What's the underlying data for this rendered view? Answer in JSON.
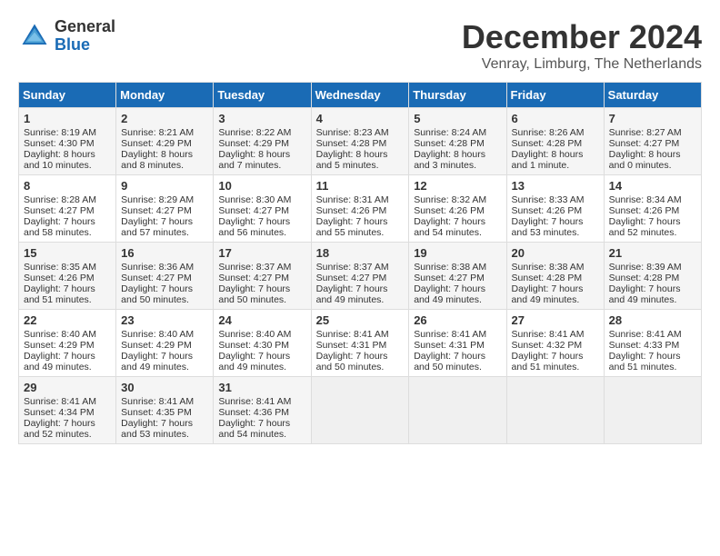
{
  "header": {
    "logo_general": "General",
    "logo_blue": "Blue",
    "month_title": "December 2024",
    "location": "Venray, Limburg, The Netherlands"
  },
  "days_of_week": [
    "Sunday",
    "Monday",
    "Tuesday",
    "Wednesday",
    "Thursday",
    "Friday",
    "Saturday"
  ],
  "weeks": [
    [
      {
        "day": "1",
        "sunrise": "Sunrise: 8:19 AM",
        "sunset": "Sunset: 4:30 PM",
        "daylight": "Daylight: 8 hours and 10 minutes."
      },
      {
        "day": "2",
        "sunrise": "Sunrise: 8:21 AM",
        "sunset": "Sunset: 4:29 PM",
        "daylight": "Daylight: 8 hours and 8 minutes."
      },
      {
        "day": "3",
        "sunrise": "Sunrise: 8:22 AM",
        "sunset": "Sunset: 4:29 PM",
        "daylight": "Daylight: 8 hours and 7 minutes."
      },
      {
        "day": "4",
        "sunrise": "Sunrise: 8:23 AM",
        "sunset": "Sunset: 4:28 PM",
        "daylight": "Daylight: 8 hours and 5 minutes."
      },
      {
        "day": "5",
        "sunrise": "Sunrise: 8:24 AM",
        "sunset": "Sunset: 4:28 PM",
        "daylight": "Daylight: 8 hours and 3 minutes."
      },
      {
        "day": "6",
        "sunrise": "Sunrise: 8:26 AM",
        "sunset": "Sunset: 4:28 PM",
        "daylight": "Daylight: 8 hours and 1 minute."
      },
      {
        "day": "7",
        "sunrise": "Sunrise: 8:27 AM",
        "sunset": "Sunset: 4:27 PM",
        "daylight": "Daylight: 8 hours and 0 minutes."
      }
    ],
    [
      {
        "day": "8",
        "sunrise": "Sunrise: 8:28 AM",
        "sunset": "Sunset: 4:27 PM",
        "daylight": "Daylight: 7 hours and 58 minutes."
      },
      {
        "day": "9",
        "sunrise": "Sunrise: 8:29 AM",
        "sunset": "Sunset: 4:27 PM",
        "daylight": "Daylight: 7 hours and 57 minutes."
      },
      {
        "day": "10",
        "sunrise": "Sunrise: 8:30 AM",
        "sunset": "Sunset: 4:27 PM",
        "daylight": "Daylight: 7 hours and 56 minutes."
      },
      {
        "day": "11",
        "sunrise": "Sunrise: 8:31 AM",
        "sunset": "Sunset: 4:26 PM",
        "daylight": "Daylight: 7 hours and 55 minutes."
      },
      {
        "day": "12",
        "sunrise": "Sunrise: 8:32 AM",
        "sunset": "Sunset: 4:26 PM",
        "daylight": "Daylight: 7 hours and 54 minutes."
      },
      {
        "day": "13",
        "sunrise": "Sunrise: 8:33 AM",
        "sunset": "Sunset: 4:26 PM",
        "daylight": "Daylight: 7 hours and 53 minutes."
      },
      {
        "day": "14",
        "sunrise": "Sunrise: 8:34 AM",
        "sunset": "Sunset: 4:26 PM",
        "daylight": "Daylight: 7 hours and 52 minutes."
      }
    ],
    [
      {
        "day": "15",
        "sunrise": "Sunrise: 8:35 AM",
        "sunset": "Sunset: 4:26 PM",
        "daylight": "Daylight: 7 hours and 51 minutes."
      },
      {
        "day": "16",
        "sunrise": "Sunrise: 8:36 AM",
        "sunset": "Sunset: 4:27 PM",
        "daylight": "Daylight: 7 hours and 50 minutes."
      },
      {
        "day": "17",
        "sunrise": "Sunrise: 8:37 AM",
        "sunset": "Sunset: 4:27 PM",
        "daylight": "Daylight: 7 hours and 50 minutes."
      },
      {
        "day": "18",
        "sunrise": "Sunrise: 8:37 AM",
        "sunset": "Sunset: 4:27 PM",
        "daylight": "Daylight: 7 hours and 49 minutes."
      },
      {
        "day": "19",
        "sunrise": "Sunrise: 8:38 AM",
        "sunset": "Sunset: 4:27 PM",
        "daylight": "Daylight: 7 hours and 49 minutes."
      },
      {
        "day": "20",
        "sunrise": "Sunrise: 8:38 AM",
        "sunset": "Sunset: 4:28 PM",
        "daylight": "Daylight: 7 hours and 49 minutes."
      },
      {
        "day": "21",
        "sunrise": "Sunrise: 8:39 AM",
        "sunset": "Sunset: 4:28 PM",
        "daylight": "Daylight: 7 hours and 49 minutes."
      }
    ],
    [
      {
        "day": "22",
        "sunrise": "Sunrise: 8:40 AM",
        "sunset": "Sunset: 4:29 PM",
        "daylight": "Daylight: 7 hours and 49 minutes."
      },
      {
        "day": "23",
        "sunrise": "Sunrise: 8:40 AM",
        "sunset": "Sunset: 4:29 PM",
        "daylight": "Daylight: 7 hours and 49 minutes."
      },
      {
        "day": "24",
        "sunrise": "Sunrise: 8:40 AM",
        "sunset": "Sunset: 4:30 PM",
        "daylight": "Daylight: 7 hours and 49 minutes."
      },
      {
        "day": "25",
        "sunrise": "Sunrise: 8:41 AM",
        "sunset": "Sunset: 4:31 PM",
        "daylight": "Daylight: 7 hours and 50 minutes."
      },
      {
        "day": "26",
        "sunrise": "Sunrise: 8:41 AM",
        "sunset": "Sunset: 4:31 PM",
        "daylight": "Daylight: 7 hours and 50 minutes."
      },
      {
        "day": "27",
        "sunrise": "Sunrise: 8:41 AM",
        "sunset": "Sunset: 4:32 PM",
        "daylight": "Daylight: 7 hours and 51 minutes."
      },
      {
        "day": "28",
        "sunrise": "Sunrise: 8:41 AM",
        "sunset": "Sunset: 4:33 PM",
        "daylight": "Daylight: 7 hours and 51 minutes."
      }
    ],
    [
      {
        "day": "29",
        "sunrise": "Sunrise: 8:41 AM",
        "sunset": "Sunset: 4:34 PM",
        "daylight": "Daylight: 7 hours and 52 minutes."
      },
      {
        "day": "30",
        "sunrise": "Sunrise: 8:41 AM",
        "sunset": "Sunset: 4:35 PM",
        "daylight": "Daylight: 7 hours and 53 minutes."
      },
      {
        "day": "31",
        "sunrise": "Sunrise: 8:41 AM",
        "sunset": "Sunset: 4:36 PM",
        "daylight": "Daylight: 7 hours and 54 minutes."
      },
      null,
      null,
      null,
      null
    ]
  ]
}
